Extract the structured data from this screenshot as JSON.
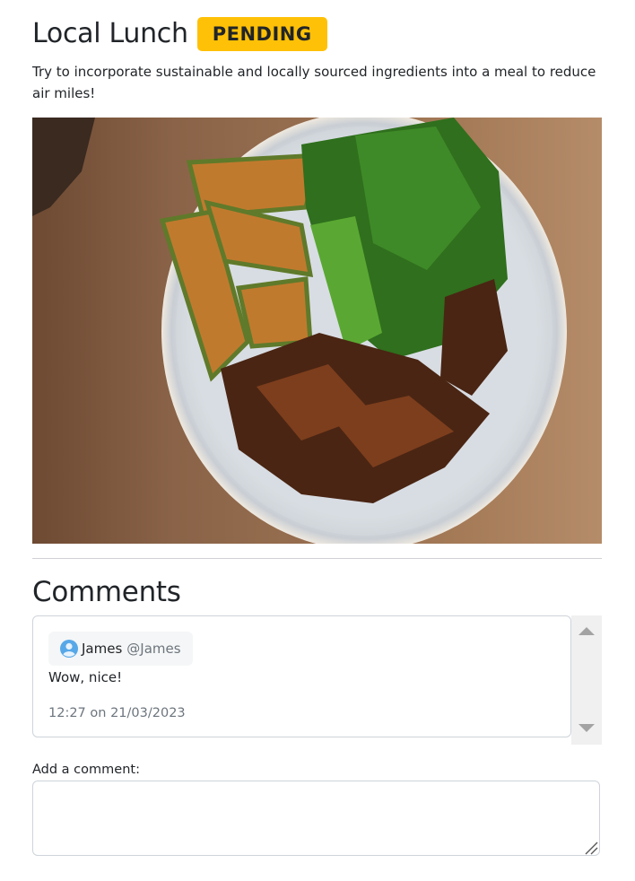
{
  "challenge": {
    "title": "Local Lunch",
    "status": "PENDING",
    "description": "Try to incorporate sustainable and locally sourced ingredients into a meal to reduce air miles!"
  },
  "comments": {
    "heading": "Comments",
    "items": [
      {
        "user_name": "James",
        "user_handle": "@James",
        "text": "Wow, nice!",
        "timestamp": "12:27 on 21/03/2023"
      }
    ]
  },
  "add_comment": {
    "label": "Add a comment:",
    "value": ""
  },
  "colors": {
    "badge": "#ffc107",
    "muted_text": "#6c757d",
    "border": "#ced4da"
  },
  "icons": {
    "avatar": "user-avatar-icon",
    "scroll_up": "triangle-up-icon",
    "scroll_down": "triangle-down-icon"
  }
}
